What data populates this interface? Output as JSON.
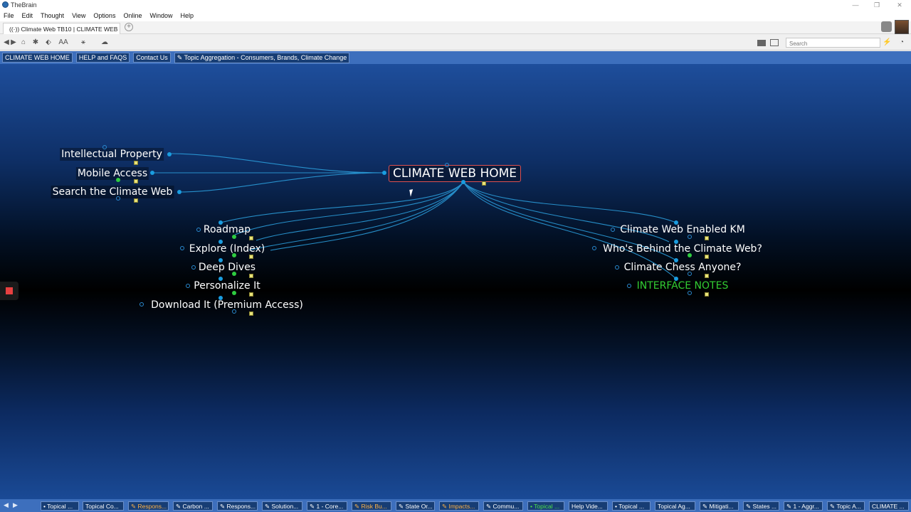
{
  "window": {
    "title": "TheBrain",
    "minimize": "—",
    "restore": "❐",
    "close": "✕"
  },
  "menu": [
    "File",
    "Edit",
    "Thought",
    "View",
    "Options",
    "Online",
    "Window",
    "Help"
  ],
  "tab": {
    "label": "((·)) Climate Web TB10 | CLIMATE WEB H...",
    "add": "+"
  },
  "toolbar": {
    "back": "◀",
    "forward": "▶",
    "home": "⌂",
    "brain": "✱",
    "tag": "⬖",
    "font": "AA",
    "layout": "⚹",
    "cloud": "☁",
    "search_placeholder": "Search",
    "sync": "⚡",
    "clock": "◔"
  },
  "breadcrumbs": [
    "CLIMATE WEB HOME",
    "HELP and FAQS",
    "Contact Us",
    "✎ Topic Aggregation - Consumers, Brands, Climate Change"
  ],
  "plex": {
    "central": "CLIMATE WEB HOME",
    "jumps": [
      "Intellectual Property",
      "Mobile Access",
      "Search the Climate Web"
    ],
    "children_left": [
      "Roadmap",
      "Explore (Index)",
      "Deep Dives",
      "Personalize It",
      "Download It (Premium Access)"
    ],
    "children_right": [
      "Climate Web Enabled KM",
      "Who's Behind the Climate Web?",
      "Climate Chess Anyone?",
      "INTERFACE NOTES"
    ]
  },
  "colors": {
    "accent_bar": "#3d6fbd",
    "link": "#2a9bd8",
    "central_border": "#e05050",
    "green_node": "#32cd32"
  },
  "pins": {
    "nav_back": "◀",
    "nav_fwd": "▶",
    "items": [
      {
        "label": "• Topical ...",
        "style": ""
      },
      {
        "label": "Topical Co...",
        "style": ""
      },
      {
        "label": "✎ Respons...",
        "style": "orange"
      },
      {
        "label": "✎ Carbon ...",
        "style": ""
      },
      {
        "label": "✎ Respons...",
        "style": ""
      },
      {
        "label": "✎ Solution...",
        "style": ""
      },
      {
        "label": "✎ 1 - Core...",
        "style": ""
      },
      {
        "label": "✎ Risk Bu...",
        "style": "orange"
      },
      {
        "label": "✎ State Or...",
        "style": ""
      },
      {
        "label": "✎ Impacts...",
        "style": "orange"
      },
      {
        "label": "✎ Commu...",
        "style": ""
      },
      {
        "label": "• Topical ...",
        "style": "green"
      },
      {
        "label": "Help Vide...",
        "style": ""
      },
      {
        "label": "• Topical ...",
        "style": ""
      },
      {
        "label": "Topical Ag...",
        "style": ""
      },
      {
        "label": "✎ Mitigati...",
        "style": ""
      },
      {
        "label": "✎ States ...",
        "style": ""
      },
      {
        "label": "✎ 1 - Aggr...",
        "style": ""
      },
      {
        "label": "✎ Topic A...",
        "style": ""
      },
      {
        "label": "CLIMATE ...",
        "style": ""
      }
    ]
  }
}
